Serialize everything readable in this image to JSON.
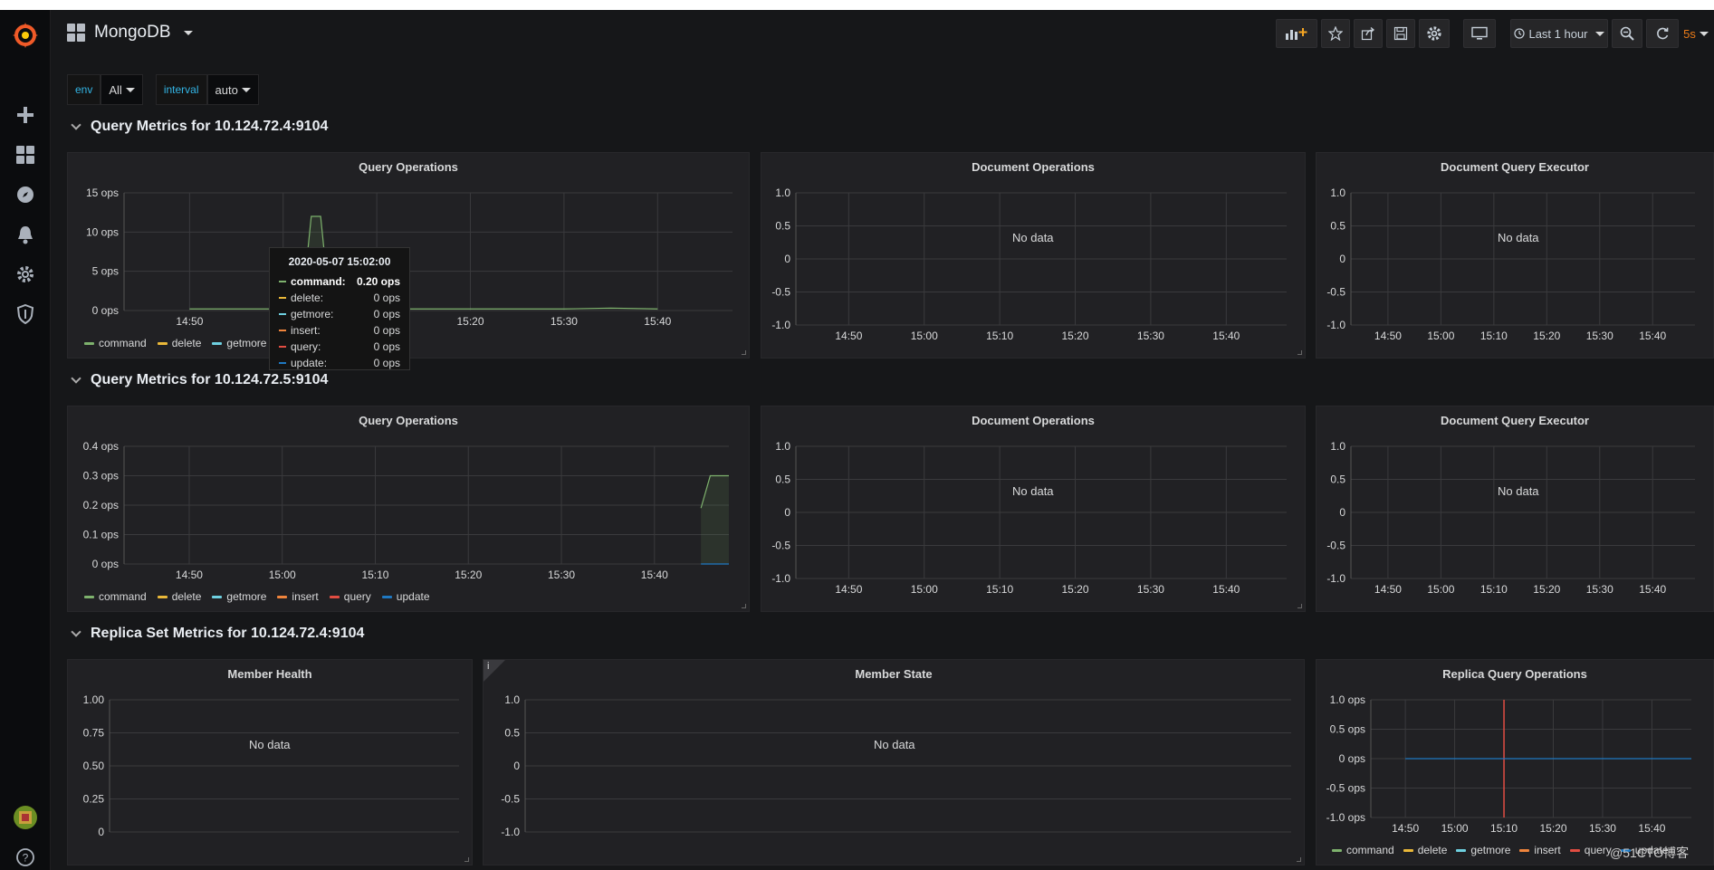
{
  "dashboard": {
    "title": "MongoDB"
  },
  "navbar": {
    "time_range": "Last 1 hour",
    "refresh": "5s"
  },
  "colors": {
    "command": "#7eb26d",
    "delete": "#eab839",
    "getmore": "#6ed0e0",
    "insert": "#ef843c",
    "query": "#e24d42",
    "update": "#1f78c1"
  },
  "variables": [
    {
      "label": "env",
      "value": "All"
    },
    {
      "label": "interval",
      "value": "auto"
    }
  ],
  "rows": [
    {
      "title": "Query Metrics for 10.124.72.4:9104"
    },
    {
      "title": "Query Metrics for 10.124.72.5:9104"
    },
    {
      "title": "Replica Set Metrics for 10.124.72.4:9104"
    }
  ],
  "panels": {
    "r1_query": {
      "title": "Query Operations"
    },
    "r1_doc": {
      "title": "Document Operations",
      "nodata": "No data"
    },
    "r1_exec": {
      "title": "Document Query Executor",
      "nodata": "No data"
    },
    "r2_query": {
      "title": "Query Operations"
    },
    "r2_doc": {
      "title": "Document Operations",
      "nodata": "No data"
    },
    "r2_exec": {
      "title": "Document Query Executor",
      "nodata": "No data"
    },
    "r3_health": {
      "title": "Member Health",
      "nodata": "No data"
    },
    "r3_state": {
      "title": "Member State",
      "nodata": "No data",
      "info": "i"
    },
    "r3_replica": {
      "title": "Replica Query Operations"
    }
  },
  "legend": [
    "command",
    "delete",
    "getmore",
    "insert",
    "query",
    "update"
  ],
  "tooltip": {
    "time": "2020-05-07 15:02:00",
    "rows": [
      {
        "name": "command:",
        "value": "0.20 ops"
      },
      {
        "name": "delete:",
        "value": "0 ops"
      },
      {
        "name": "getmore:",
        "value": "0 ops"
      },
      {
        "name": "insert:",
        "value": "0 ops"
      },
      {
        "name": "query:",
        "value": "0 ops"
      },
      {
        "name": "update:",
        "value": "0 ops"
      }
    ]
  },
  "chart_data": [
    {
      "type": "line",
      "id": "r1_query",
      "title": "Query Operations",
      "x_ticks": [
        "14:50",
        "15:00",
        "15:10",
        "15:20",
        "15:30",
        "15:40"
      ],
      "y_ticks": [
        "0 ops",
        "5 ops",
        "10 ops",
        "15 ops"
      ],
      "ylim": [
        0,
        15
      ],
      "series": [
        {
          "name": "command",
          "x": [
            "14:50",
            "15:00",
            "15:02",
            "15:03",
            "15:04",
            "15:05",
            "15:30",
            "15:35",
            "15:40"
          ],
          "values": [
            0.2,
            0.2,
            0.2,
            12,
            12,
            0.2,
            0.2,
            0.3,
            0.2
          ]
        },
        {
          "name": "delete",
          "values": []
        },
        {
          "name": "getmore",
          "values": []
        },
        {
          "name": "insert",
          "values": []
        },
        {
          "name": "query",
          "values": []
        },
        {
          "name": "update",
          "values": []
        }
      ]
    },
    {
      "type": "line",
      "id": "r1_doc",
      "title": "Document Operations",
      "x_ticks": [
        "14:50",
        "15:00",
        "15:10",
        "15:20",
        "15:30",
        "15:40"
      ],
      "y_ticks": [
        "-1.0",
        "-0.5",
        "0",
        "0.5",
        "1.0"
      ],
      "ylim": [
        -1,
        1
      ],
      "series": []
    },
    {
      "type": "line",
      "id": "r1_exec",
      "title": "Document Query Executor",
      "x_ticks": [
        "14:50",
        "15:00",
        "15:10",
        "15:20",
        "15:30",
        "15:40"
      ],
      "y_ticks": [
        "-1.0",
        "-0.5",
        "0",
        "0.5",
        "1.0"
      ],
      "ylim": [
        -1,
        1
      ],
      "series": []
    },
    {
      "type": "line",
      "id": "r2_query",
      "title": "Query Operations",
      "x_ticks": [
        "14:50",
        "15:00",
        "15:10",
        "15:20",
        "15:30",
        "15:40"
      ],
      "y_ticks": [
        "0 ops",
        "0.1 ops",
        "0.2 ops",
        "0.3 ops",
        "0.4 ops"
      ],
      "ylim": [
        0,
        0.4
      ],
      "series": [
        {
          "name": "command",
          "x": [
            "15:45",
            "15:46",
            "15:48"
          ],
          "values": [
            0.19,
            0.3,
            0.3
          ]
        },
        {
          "name": "update",
          "x": [
            "15:45",
            "15:48"
          ],
          "values": [
            0,
            0
          ]
        }
      ]
    },
    {
      "type": "line",
      "id": "r2_doc",
      "title": "Document Operations",
      "x_ticks": [
        "14:50",
        "15:00",
        "15:10",
        "15:20",
        "15:30",
        "15:40"
      ],
      "y_ticks": [
        "-1.0",
        "-0.5",
        "0",
        "0.5",
        "1.0"
      ],
      "ylim": [
        -1,
        1
      ],
      "series": []
    },
    {
      "type": "line",
      "id": "r2_exec",
      "title": "Document Query Executor",
      "x_ticks": [
        "14:50",
        "15:00",
        "15:10",
        "15:20",
        "15:30",
        "15:40"
      ],
      "y_ticks": [
        "-1.0",
        "-0.5",
        "0",
        "0.5",
        "1.0"
      ],
      "ylim": [
        -1,
        1
      ],
      "series": []
    },
    {
      "type": "line",
      "id": "r3_health",
      "title": "Member Health",
      "x_ticks": [],
      "y_ticks": [
        "0",
        "0.25",
        "0.50",
        "0.75",
        "1.00"
      ],
      "ylim": [
        0,
        1
      ],
      "series": []
    },
    {
      "type": "line",
      "id": "r3_state",
      "title": "Member State",
      "x_ticks": [],
      "y_ticks": [
        "-1.0",
        "-0.5",
        "0",
        "0.5",
        "1.0"
      ],
      "ylim": [
        -1,
        1
      ],
      "series": []
    },
    {
      "type": "line",
      "id": "r3_replica",
      "title": "Replica Query Operations",
      "x_ticks": [
        "14:50",
        "15:00",
        "15:10",
        "15:20",
        "15:30",
        "15:40"
      ],
      "y_ticks": [
        "-1.0 ops",
        "-0.5 ops",
        "0 ops",
        "0.5 ops",
        "1.0 ops"
      ],
      "ylim": [
        -1,
        1
      ],
      "series": [
        {
          "name": "update",
          "x": [
            "14:50",
            "15:48"
          ],
          "values": [
            0,
            0
          ]
        }
      ],
      "marker_x": "15:10"
    }
  ],
  "watermark": "@51CTO博客"
}
